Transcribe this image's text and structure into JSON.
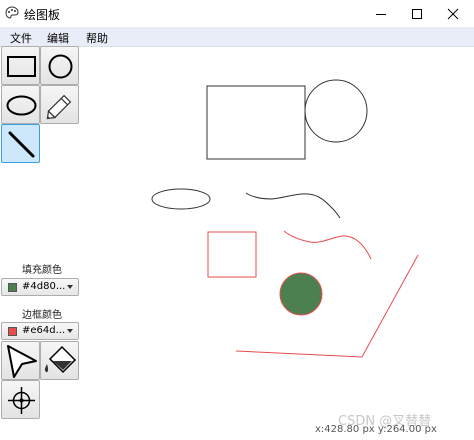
{
  "window": {
    "title": "绘图板",
    "icon": "app-palette-icon",
    "controls": [
      "minimize-icon",
      "maximize-icon",
      "close-icon"
    ]
  },
  "menu": {
    "items": [
      "文件",
      "编辑",
      "帮助"
    ]
  },
  "tools": [
    {
      "name": "rectangle-tool",
      "icon": "rectangle-icon"
    },
    {
      "name": "circle-tool",
      "icon": "circle-icon"
    },
    {
      "name": "ellipse-tool",
      "icon": "ellipse-icon"
    },
    {
      "name": "pencil-tool",
      "icon": "pencil-icon",
      "active": false
    },
    {
      "name": "line-tool",
      "icon": "line-icon",
      "active": true
    },
    {
      "name": "select-tool",
      "icon": "cursor-icon"
    },
    {
      "name": "fill-tool",
      "icon": "paint-bucket-icon"
    },
    {
      "name": "crosshair-tool",
      "icon": "crosshair-icon"
    }
  ],
  "fill_color": {
    "label": "填充颜色",
    "value": "#4d80...",
    "swatch": "#4d8050"
  },
  "border_color": {
    "label": "边框颜色",
    "value": "#e64d...",
    "swatch": "#e64d4d"
  },
  "status": {
    "text": "x:428.80 px y:264.00 px"
  },
  "watermark": {
    "text": "CSDN @叉替替"
  },
  "colors": {
    "menubar": "#e9edf8",
    "active_tool": "#cde8fb",
    "shape_fill": "#4d8050",
    "shape_stroke_red": "#e64d4d"
  }
}
